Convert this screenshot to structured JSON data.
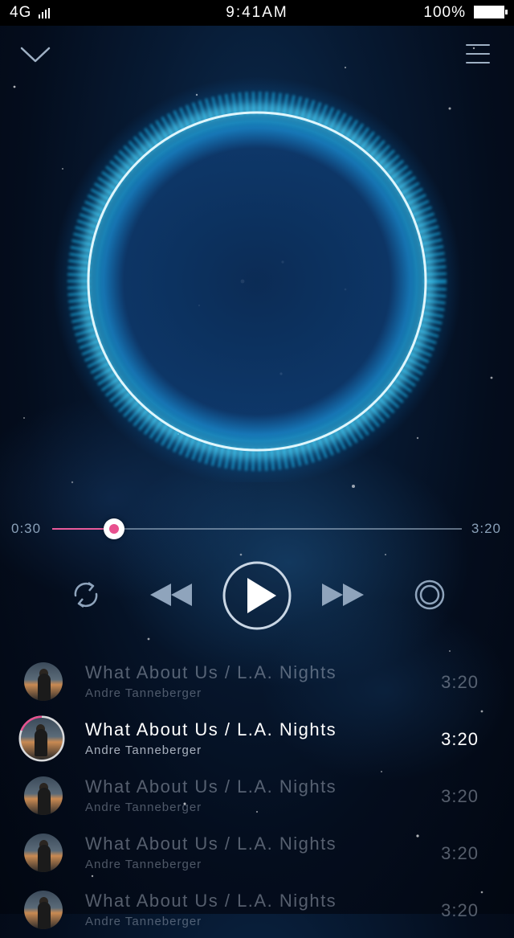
{
  "status": {
    "carrier": "4G",
    "time": "9:41AM",
    "battery": "100%"
  },
  "player": {
    "current_time": "0:30",
    "total_time": "3:20",
    "progress": 0.15
  },
  "controls": {
    "repeat": "repeat-icon",
    "previous": "rewind-icon",
    "play": "play-icon",
    "next": "fast-forward-icon",
    "disc": "disc-icon"
  },
  "colors": {
    "accent": "#e8508e",
    "ring": "#2ec8ff"
  },
  "playlist": [
    {
      "title": "What About Us / L.A. Nights",
      "artist": "Andre Tanneberger",
      "duration": "3:20"
    },
    {
      "title": "What About Us / L.A. Nights",
      "artist": "Andre Tanneberger",
      "duration": "3:20"
    },
    {
      "title": "What About Us / L.A. Nights",
      "artist": "Andre Tanneberger",
      "duration": "3:20"
    },
    {
      "title": "What About Us / L.A. Nights",
      "artist": "Andre Tanneberger",
      "duration": "3:20"
    },
    {
      "title": "What About Us / L.A. Nights",
      "artist": "Andre Tanneberger",
      "duration": "3:20"
    }
  ]
}
